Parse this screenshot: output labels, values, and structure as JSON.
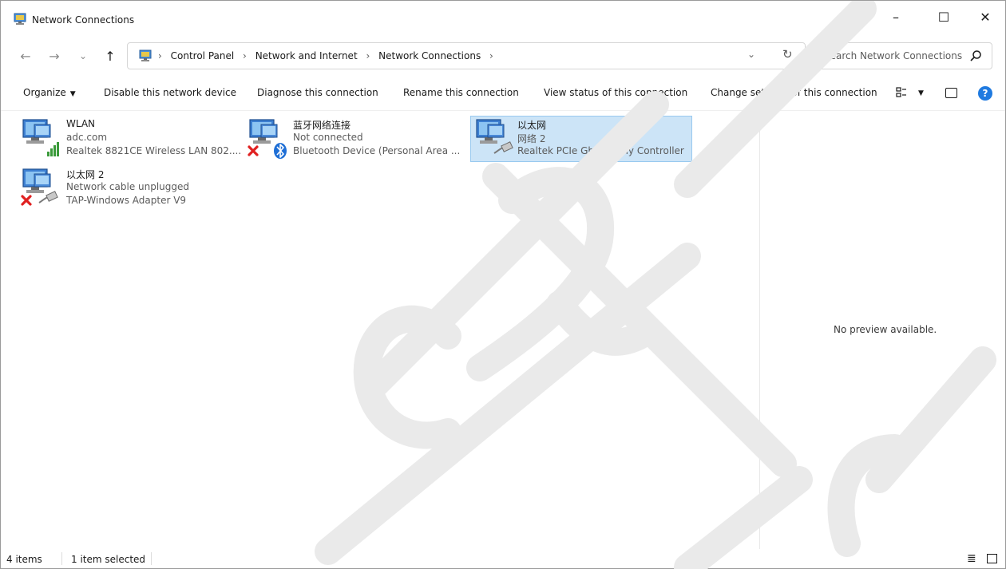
{
  "window": {
    "title": "Network Connections",
    "minimize": "–",
    "maximize": "☐",
    "close": "✕"
  },
  "nav": {
    "back": "←",
    "forward": "→",
    "recent": "⌄",
    "up": "↑"
  },
  "address": {
    "crumbs": [
      "Control Panel",
      "Network and Internet",
      "Network Connections"
    ],
    "separator": "›",
    "dropdown": "⌄",
    "refresh": "↻"
  },
  "search": {
    "placeholder": "Search Network Connections"
  },
  "commands": {
    "organize": "Organize",
    "disable": "Disable this network device",
    "diagnose": "Diagnose this connection",
    "rename": "Rename this connection",
    "view_status": "View status of this connection",
    "change_settings": "Change settings of this connection",
    "help": "?"
  },
  "connections": [
    {
      "name": "WLAN",
      "status": "adc.com",
      "device": "Realtek 8821CE Wireless LAN 802....",
      "badge": "signal",
      "selected": false
    },
    {
      "name": "蓝牙网络连接",
      "status": "Not connected",
      "device": "Bluetooth Device (Personal Area ...",
      "badge": "bluetooth-disconnected",
      "selected": false
    },
    {
      "name": "以太网",
      "status": "网络 2",
      "device": "Realtek PCIe GbE Family Controller",
      "badge": "cable",
      "selected": true
    },
    {
      "name": "以太网 2",
      "status": "Network cable unplugged",
      "device": "TAP-Windows Adapter V9",
      "badge": "cable-disconnected",
      "selected": false
    }
  ],
  "preview": {
    "message": "No preview available."
  },
  "statusbar": {
    "item_count": "4 items",
    "selection": "1 item selected"
  },
  "colors": {
    "selection_bg": "#cce4f7",
    "selection_border": "#99c9ef",
    "accent": "#1f7ae0",
    "error": "#e02020",
    "signal": "#3a9a3a"
  }
}
